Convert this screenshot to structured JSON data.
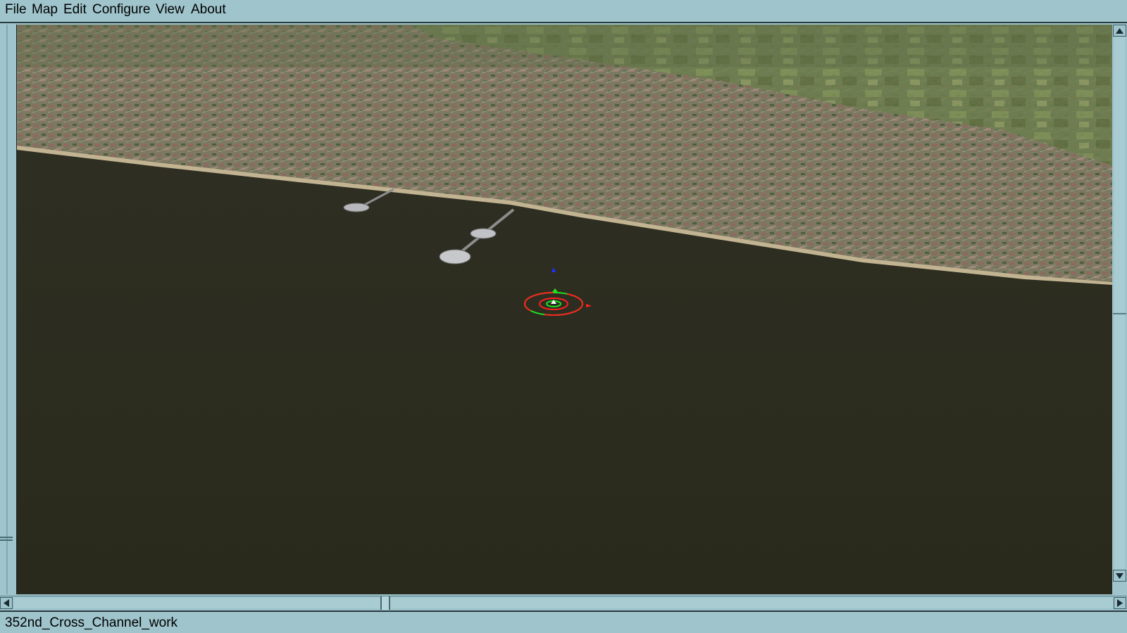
{
  "menu": {
    "file": "File",
    "map": "Map",
    "edit": "Edit",
    "configure": "Configure",
    "view": "View",
    "about": "About"
  },
  "status": {
    "mission_name": "352nd_Cross_Channel_work"
  },
  "viewport": {
    "scene": "aerial view of coastline with piers",
    "selection_marker_colors": {
      "outer_ring": "#ff2020",
      "inner_ring": "#20e020",
      "up_axis": "#2030ff"
    }
  },
  "scrollbars": {
    "vertical_arrow_up": "triangle-up-icon",
    "vertical_arrow_down": "triangle-down-icon",
    "horizontal_arrow_left": "triangle-left-icon",
    "horizontal_arrow_right": "triangle-right-icon"
  }
}
